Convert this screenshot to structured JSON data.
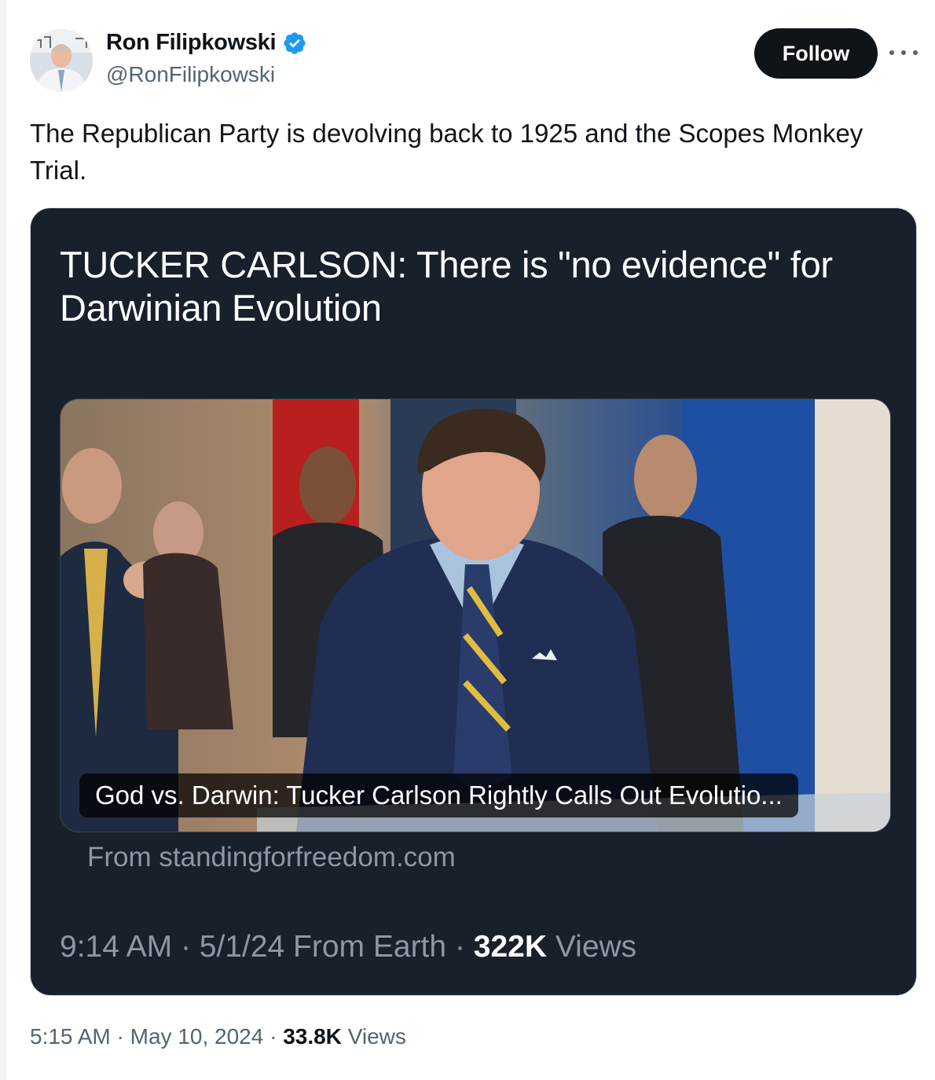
{
  "author": {
    "display_name": "Ron Filipkowski",
    "handle": "@RonFilipkowski",
    "verified_icon": "verified-badge-icon",
    "verified_color": "#1d9bf0"
  },
  "actions": {
    "follow_label": "Follow",
    "more_icon": "more-horizontal-icon"
  },
  "tweet": {
    "text": "The Republican Party is devolving back to 1925 and the Scopes Monkey Trial."
  },
  "quote": {
    "headline": "TUCKER CARLSON: There is \"no evidence\" for Darwinian Evolution",
    "card_caption": "God vs. Darwin: Tucker Carlson Rightly Calls Out Evolutio...",
    "source": "From standingforfreedom.com",
    "time": "9:14 AM",
    "date": "5/1/24",
    "location": "From Earth",
    "views_count": "322K",
    "views_label": "Views",
    "background": "#17202b"
  },
  "meta": {
    "time": "5:15 AM",
    "date": "May 10, 2024",
    "views_count": "33.8K",
    "views_label": "Views"
  }
}
